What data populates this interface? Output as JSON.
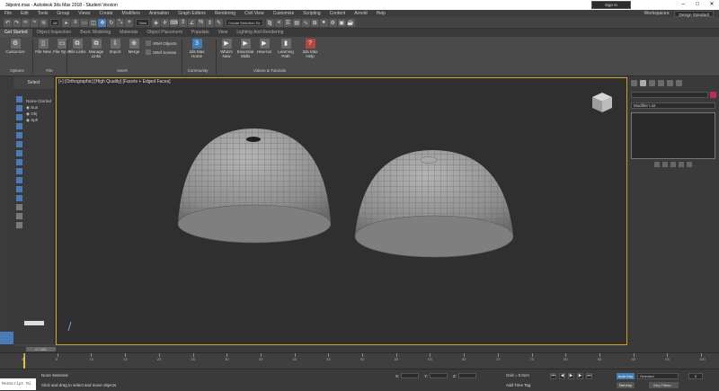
{
  "window": {
    "title": "3dpoint.max - Autodesk 3ds Max 2018 - Student Version"
  },
  "menu": [
    "File",
    "Edit",
    "Tools",
    "Group",
    "Views",
    "Create",
    "Modifiers",
    "Animation",
    "Graph Editors",
    "Rendering",
    "Civil View",
    "Customize",
    "Scripting",
    "Content",
    "Arnold",
    "Help"
  ],
  "account": {
    "sign_in": "Sign In",
    "workspaces_label": "Workspaces:",
    "workspace": "Design Standard"
  },
  "toolbar": {
    "filter": "All",
    "ref_coord": "View",
    "named_sel": "Create Selection Se"
  },
  "ribbon_tabs": [
    "Get Started",
    "Object Inspection",
    "Basic Modeling",
    "Materials",
    "Object Placement",
    "Populate",
    "View",
    "Lighting And Rendering"
  ],
  "ribbon": {
    "options": {
      "button": "Customize",
      "label": "Options"
    },
    "file": {
      "new": "File New",
      "open": "File Open",
      "label": "File"
    },
    "insert": {
      "links": "File Links",
      "manage": "Manage Links",
      "import": "Import",
      "merge": "Merge",
      "xref_objects": "XRef Objects",
      "xref_scenes": "XRef Scenes",
      "label": "Insert"
    },
    "community": {
      "home": "3ds Max Home",
      "label": "Community"
    },
    "videos": {
      "whats_new": "What's New",
      "essential": "Essential Skills",
      "howtos": "How-tos",
      "learning": "Learning Path",
      "help": "3ds Max Help",
      "label": "Videos & Tutorials"
    }
  },
  "explorer": {
    "select": "Select",
    "header": "Name (Sorted",
    "items": [
      "Sun",
      "Obj",
      "Sph"
    ]
  },
  "viewport": {
    "label": "[+] [Orthographic] [High Quality] [Facets + Edged Faces]"
  },
  "modifier_list": "Modifier List",
  "timebar": {
    "frame": "0 / 100"
  },
  "timeline": {
    "ticks": [
      "0",
      "5",
      "10",
      "15",
      "20",
      "25",
      "30",
      "35",
      "40",
      "45",
      "50",
      "55",
      "60",
      "65",
      "70",
      "75",
      "80",
      "85",
      "90",
      "95",
      "100"
    ]
  },
  "status": {
    "maxscript": "MAXScript Mi",
    "selected": "None Selected",
    "prompt": "Click and drag to select and move objects",
    "x": "X:",
    "y": "Y:",
    "z": "Z:",
    "grid": "Grid = 0.0cm",
    "add_time_tag": "Add Time Tag",
    "auto_key": "Auto Key",
    "set_key": "Set Key",
    "selected_dd": "Selected",
    "key_filters": "Key Filters...",
    "frame": "0"
  }
}
